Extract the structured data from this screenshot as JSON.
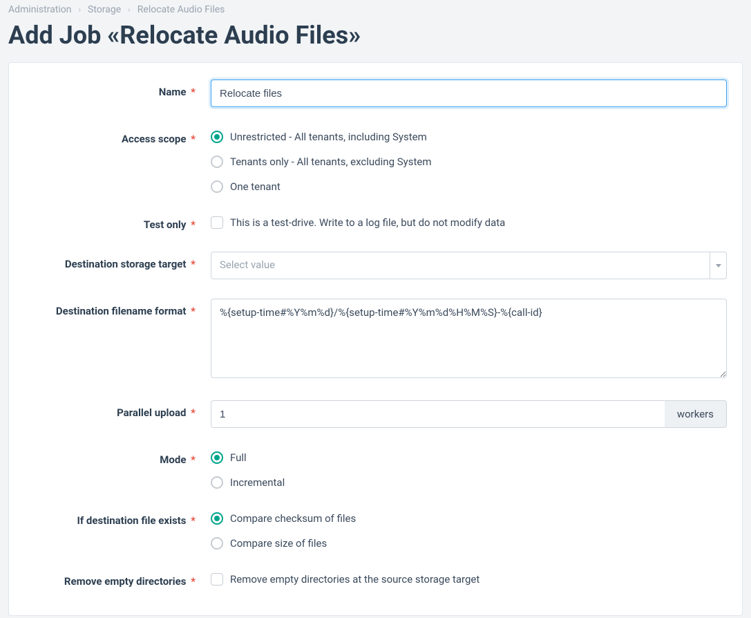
{
  "breadcrumb": {
    "items": [
      "Administration",
      "Storage",
      "Relocate Audio Files"
    ]
  },
  "page_title": "Add Job «Relocate Audio Files»",
  "labels": {
    "name": "Name",
    "access_scope": "Access scope",
    "test_only": "Test only",
    "dest_storage": "Destination storage target",
    "dest_filename": "Destination filename format",
    "parallel_upload": "Parallel upload",
    "mode": "Mode",
    "if_dest_exists": "If destination file exists",
    "remove_empty": "Remove empty directories"
  },
  "name": {
    "value": "Relocate files"
  },
  "access_scope": {
    "options": [
      {
        "label": "Unrestricted - All tenants, including System",
        "selected": true
      },
      {
        "label": "Tenants only - All tenants, excluding System",
        "selected": false
      },
      {
        "label": "One tenant",
        "selected": false
      }
    ]
  },
  "test_only": {
    "label": "This is a test-drive. Write to a log file, but do not modify data",
    "checked": false
  },
  "dest_storage": {
    "placeholder": "Select value"
  },
  "dest_filename": {
    "value": "%{setup-time#%Y%m%d}/%{setup-time#%Y%m%d%H%M%S}-%{call-id}"
  },
  "parallel_upload": {
    "value": "1",
    "addon": "workers"
  },
  "mode": {
    "options": [
      {
        "label": "Full",
        "selected": true
      },
      {
        "label": "Incremental",
        "selected": false
      }
    ]
  },
  "if_dest_exists": {
    "options": [
      {
        "label": "Compare checksum of files",
        "selected": true
      },
      {
        "label": "Compare size of files",
        "selected": false
      }
    ]
  },
  "remove_empty": {
    "label": "Remove empty directories at the source storage target",
    "checked": false
  }
}
